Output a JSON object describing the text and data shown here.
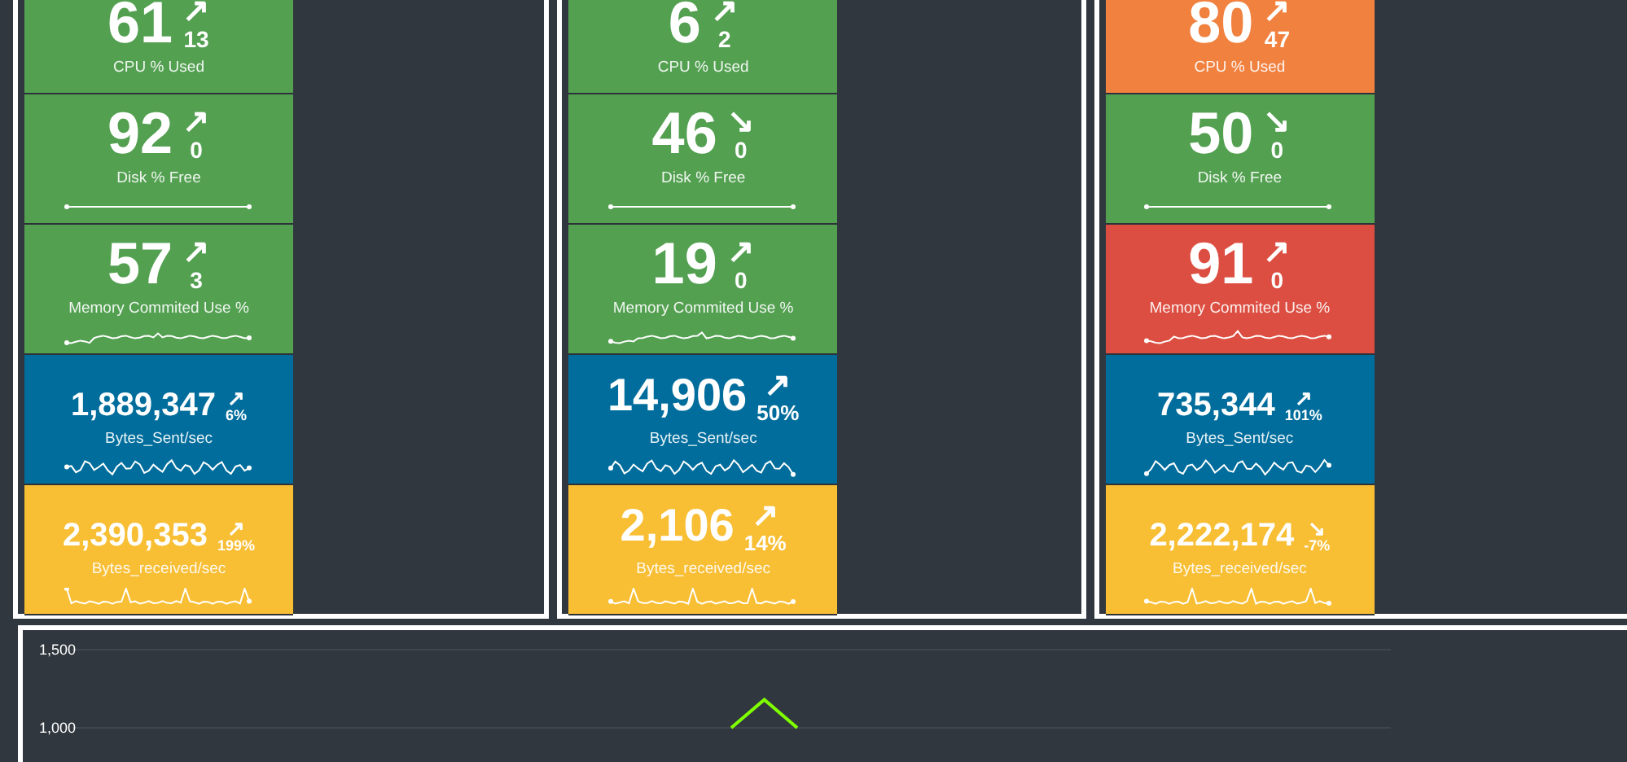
{
  "panels": [
    {
      "tiles": [
        {
          "kind": "percent",
          "value": "61",
          "arrow": "↗",
          "delta": "13",
          "label": "CPU % Used",
          "color": "#53a051"
        },
        {
          "kind": "percent",
          "value": "92",
          "arrow": "↗",
          "delta": "0",
          "label": "Disk % Free",
          "color": "#53a051"
        },
        {
          "kind": "percent",
          "value": "57",
          "arrow": "↗",
          "delta": "3",
          "label": "Memory Commited Use %",
          "color": "#53a051"
        },
        {
          "kind": "rate",
          "value": "1,889,347",
          "arrow": "↗",
          "delta": "6%",
          "label": "Bytes_Sent/sec",
          "color": "#006d9c"
        },
        {
          "kind": "rate",
          "value": "2,390,353",
          "arrow": "↗",
          "delta": "199%",
          "label": "Bytes_received/sec",
          "color": "#f8be34"
        }
      ]
    },
    {
      "tiles": [
        {
          "kind": "percent",
          "value": "6",
          "arrow": "↗",
          "delta": "2",
          "label": "CPU % Used",
          "color": "#53a051"
        },
        {
          "kind": "percent",
          "value": "46",
          "arrow": "↘",
          "delta": "0",
          "label": "Disk % Free",
          "color": "#53a051"
        },
        {
          "kind": "percent",
          "value": "19",
          "arrow": "↗",
          "delta": "0",
          "label": "Memory Commited Use %",
          "color": "#53a051"
        },
        {
          "kind": "mid",
          "value": "14,906",
          "arrow": "↗",
          "delta": "50%",
          "label": "Bytes_Sent/sec",
          "color": "#006d9c"
        },
        {
          "kind": "mid",
          "value": "2,106",
          "arrow": "↗",
          "delta": "14%",
          "label": "Bytes_received/sec",
          "color": "#f8be34"
        }
      ]
    },
    {
      "tiles": [
        {
          "kind": "percent",
          "value": "80",
          "arrow": "↗",
          "delta": "47",
          "label": "CPU % Used",
          "color": "#f1813f"
        },
        {
          "kind": "percent",
          "value": "50",
          "arrow": "↘",
          "delta": "0",
          "label": "Disk % Free",
          "color": "#53a051"
        },
        {
          "kind": "percent",
          "value": "91",
          "arrow": "↗",
          "delta": "0",
          "label": "Memory Commited Use %",
          "color": "#dc4e41"
        },
        {
          "kind": "rate",
          "value": "735,344",
          "arrow": "↗",
          "delta": "101%",
          "label": "Bytes_Sent/sec",
          "color": "#006d9c"
        },
        {
          "kind": "rate",
          "value": "2,222,174",
          "arrow": "↘",
          "delta": "-7%",
          "label": "Bytes_received/sec",
          "color": "#f8be34"
        }
      ]
    }
  ],
  "chart": {
    "chart_data": {
      "type": "line",
      "ylim": [
        1000,
        1500
      ],
      "yticks": [
        {
          "value": 1000,
          "label": "1,000"
        },
        {
          "value": 1500,
          "label": "1,500"
        }
      ],
      "series": [
        {
          "color": "#7fff00",
          "values": [
            null,
            null,
            null,
            null,
            null,
            null,
            null,
            null,
            null,
            null,
            null,
            null,
            null,
            null,
            null,
            null,
            null,
            null,
            null,
            null,
            1000,
            1180,
            1000,
            null,
            null,
            null,
            null,
            null,
            null,
            null,
            null,
            null,
            null,
            null,
            null,
            null,
            null,
            null,
            null,
            null,
            null
          ]
        }
      ]
    }
  }
}
